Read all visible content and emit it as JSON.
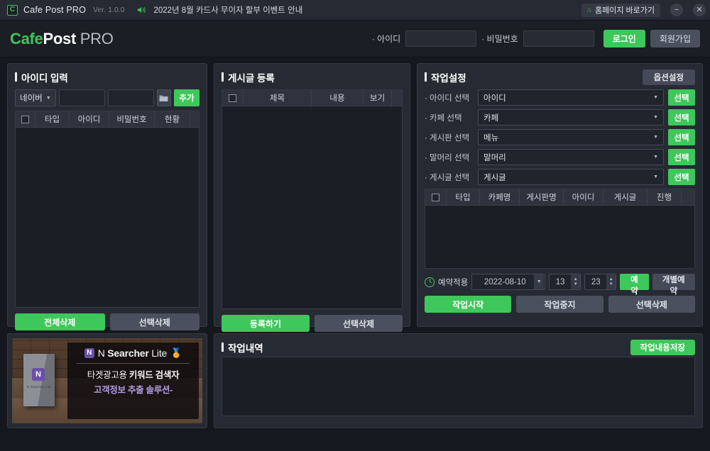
{
  "titlebar": {
    "app_icon": "app-logo-icon",
    "title": "Cafe Post PRO",
    "version": "Ver. 1.0.0",
    "speaker_icon": "speaker-icon",
    "notice": "2022년 8월 카드사 무이자 할부 이벤트 안내",
    "home_icon": "home-icon",
    "home_label": "홈페이지 바로가기",
    "minimize": "−",
    "close": "✕"
  },
  "header": {
    "logo": {
      "cafe": "Cafe",
      "post": "Post",
      "pro": "PRO"
    },
    "login": {
      "id_label": "· 아이디",
      "id_value": "",
      "pw_label": "· 비밀번호",
      "pw_value": "",
      "login_button": "로그인",
      "signup_button": "회원가입"
    }
  },
  "id_panel": {
    "title": "아이디 입력",
    "site_select": "네이버",
    "id_input": "",
    "pw_input": "",
    "folder_icon": "folder-icon",
    "add_button": "추가",
    "columns": [
      "",
      "타입",
      "아이디",
      "비밀번호",
      "현황",
      ""
    ],
    "rows": [],
    "delete_all_button": "전체삭제",
    "delete_selected_button": "선택삭제"
  },
  "post_panel": {
    "title": "게시글 등록",
    "columns": [
      "",
      "제목",
      "내용",
      "보기",
      ""
    ],
    "rows": [],
    "register_button": "등록하기",
    "delete_selected_button": "선택삭제"
  },
  "task_panel": {
    "title": "작업설정",
    "option_button": "옵션설정",
    "fields": [
      {
        "label": "· 아이디 선택",
        "value": "아이디",
        "button": "선택"
      },
      {
        "label": "· 카페 선택",
        "value": "카페",
        "button": "선택"
      },
      {
        "label": "· 게시판 선택",
        "value": "메뉴",
        "button": "선택"
      },
      {
        "label": "· 말머리 선택",
        "value": "말머리",
        "button": "선택"
      },
      {
        "label": "· 게시글 선택",
        "value": "게시글",
        "button": "선택"
      }
    ],
    "columns": [
      "",
      "타입",
      "카페명",
      "게시판명",
      "아이디",
      "게시글",
      "진행",
      ""
    ],
    "rows": [],
    "schedule": {
      "clock_icon": "clock-icon",
      "label": "예약적용",
      "date": "2022-08-10",
      "hour": "13",
      "minute": "23",
      "reserve_button": "예약",
      "individual_button": "개별예약"
    },
    "start_button": "작업시작",
    "stop_button": "작업중지",
    "delete_selected_button": "선택삭제"
  },
  "ad_panel": {
    "brand_badge": "N",
    "brand_name_regular": "N ",
    "brand_name_bold": "Searcher",
    "brand_name_tail": " Lite",
    "medal_icon": "medal-icon",
    "line1_a": "타겟광고용 ",
    "line1_b": "키워드 검색자",
    "line2": "고객정보 추출 솔루션-",
    "box_badge": "N",
    "box_caption": "N Searcher Lite"
  },
  "history_panel": {
    "title": "작업내역",
    "save_button": "작업내용저장",
    "log_text": ""
  },
  "colors": {
    "accent_green": "#3ec75a",
    "panel_bg": "#262a33",
    "window_bg": "#15181e",
    "field_bg": "#20242c",
    "gray_button": "#4a505d"
  }
}
